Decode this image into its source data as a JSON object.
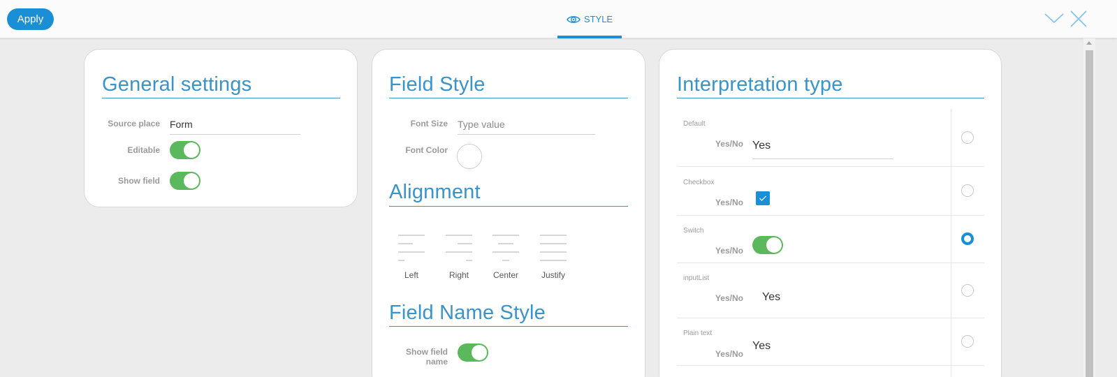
{
  "toolbar": {
    "apply_label": "Apply",
    "tab_label": "STYLE",
    "tab_icon": "eye-icon",
    "chevron_icon": "chevron-down-icon",
    "close_icon": "close-icon"
  },
  "general": {
    "title": "General settings",
    "source_place_label": "Source place",
    "source_place_value": "Form",
    "editable_label": "Editable",
    "editable_on": true,
    "show_field_label": "Show field",
    "show_field_on": true
  },
  "field_style": {
    "title": "Field Style",
    "font_size_label": "Font Size",
    "font_size_placeholder": "Type value",
    "font_color_label": "Font Color",
    "alignment_title": "Alignment",
    "alignments": [
      "Left",
      "Right",
      "Center",
      "Justify"
    ],
    "field_name_title": "Field Name Style",
    "show_field_name_label_1": "Show field",
    "show_field_name_label_2": "name",
    "show_field_name_on": true
  },
  "interpretation": {
    "title": "Interpretation type",
    "rows": [
      {
        "name": "Default",
        "label": "Yes/No",
        "value": "Yes",
        "selected": false
      },
      {
        "name": "Checkbox",
        "label": "Yes/No",
        "value": "",
        "selected": false
      },
      {
        "name": "Switch",
        "label": "Yes/No",
        "value": "",
        "selected": true
      },
      {
        "name": "inputList",
        "label": "Yes/No",
        "value": "Yes",
        "selected": false
      },
      {
        "name": "Plain text",
        "label": "Yes/No",
        "value": "Yes",
        "selected": false
      }
    ]
  },
  "colors": {
    "accent": "#1a8fd6",
    "title_blue": "#3a93c9",
    "toggle_on": "#5cb85c"
  }
}
